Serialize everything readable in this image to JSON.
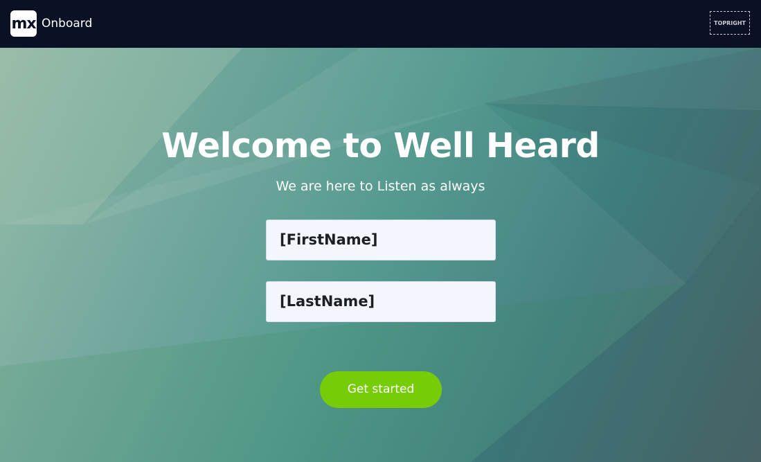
{
  "header": {
    "logo_text": "mx",
    "app_name": "Onboard",
    "topright_label": "TOPRIGHT"
  },
  "hero": {
    "title": "Welcome to Well Heard",
    "subtitle": "We are here to Listen as always"
  },
  "form": {
    "first_name_value": "[FirstName]",
    "last_name_value": "[LastName]",
    "submit_label": "Get started"
  },
  "colors": {
    "topbar": "#0b1124",
    "button": "#76cc07",
    "field_bg": "#f3f6fc"
  }
}
